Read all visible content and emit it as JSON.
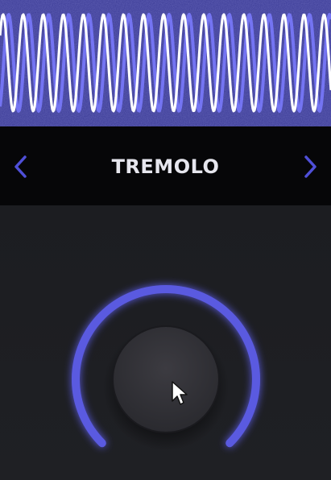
{
  "app": {
    "effect_name": "TREMOLO"
  },
  "navigation": {
    "prev_icon": "chevron-left-icon",
    "next_icon": "chevron-right-icon"
  },
  "knob": {
    "value": 1.0,
    "min": 0,
    "max": 1
  },
  "colors": {
    "accent": "#5a5ae0",
    "waveform_bg": "#3a3a95",
    "waveform_primary": "#ffffff",
    "waveform_secondary": "#7070f0",
    "preset_bar_bg": "#060608",
    "panel_bg": "#1e1f23"
  }
}
